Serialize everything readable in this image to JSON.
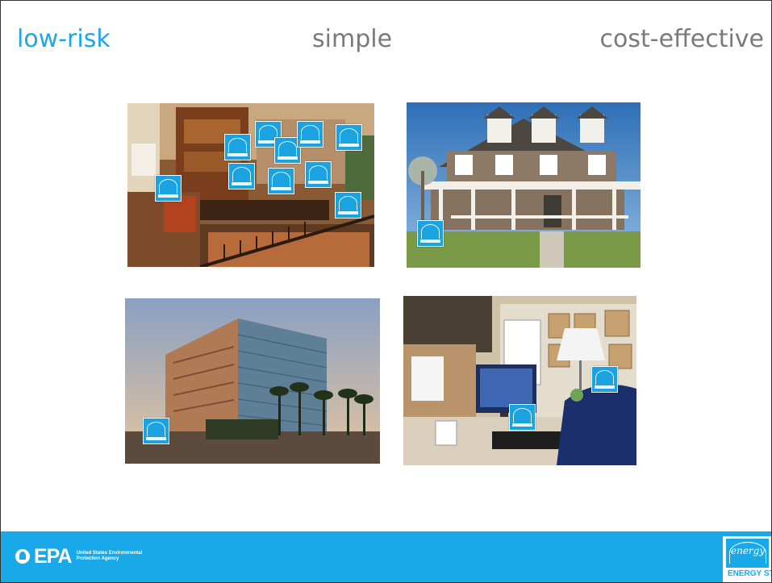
{
  "header": {
    "low_risk": "low-risk",
    "simple": "simple",
    "cost_effective": "cost-effective"
  },
  "photos": {
    "kitchen": {
      "icon": "kitchen-photo",
      "label_badges": 11
    },
    "house": {
      "icon": "house-photo",
      "label_badges": 1
    },
    "office_building": {
      "icon": "office-building-photo",
      "label_badges": 1
    },
    "cubicle": {
      "icon": "cubicle-photo",
      "label_badges": 2
    }
  },
  "footer": {
    "epa_word": "EPA",
    "epa_sub": "United States Environmental Protection Agency",
    "energy_star_script": "energy",
    "energy_star_label": "ENERGY STAR"
  },
  "colors": {
    "accent": "#1ea7e6",
    "footer_bg": "#1aa9e8",
    "header_gray": "#7a7a7a"
  }
}
